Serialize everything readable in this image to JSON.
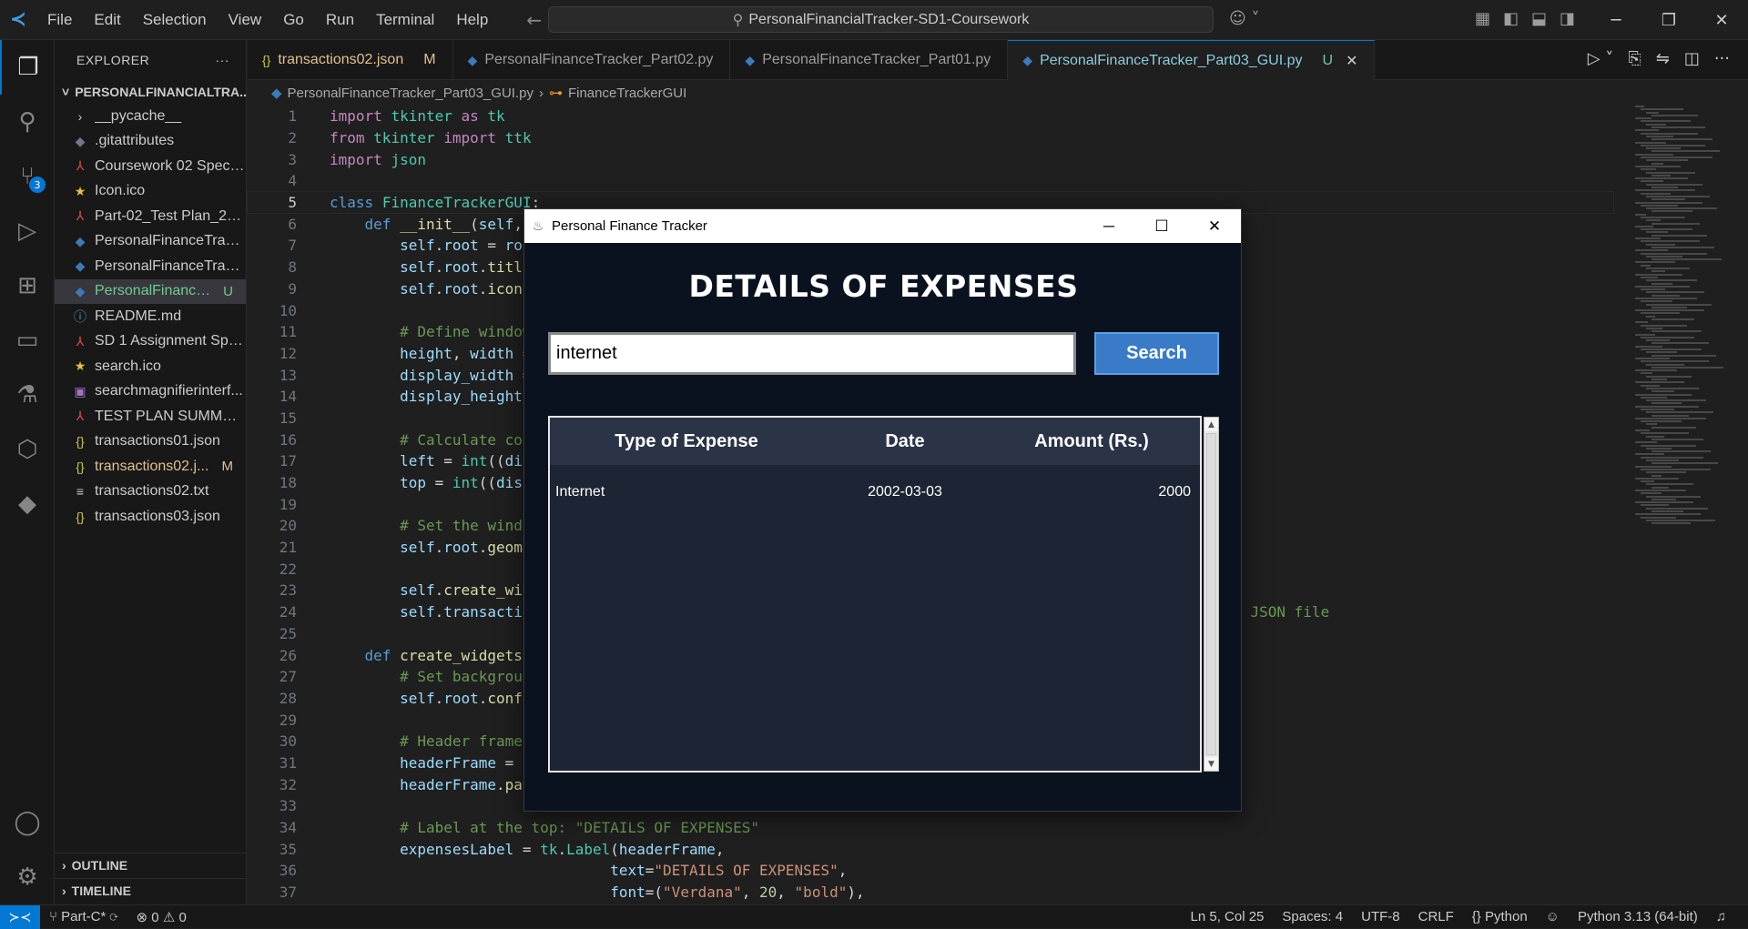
{
  "titlebar": {
    "menus": [
      "File",
      "Edit",
      "Selection",
      "View",
      "Go",
      "Run",
      "Terminal",
      "Help"
    ],
    "search_text": "PersonalFinancialTracker-SD1-Coursework"
  },
  "explorer": {
    "title": "EXPLORER",
    "root": "PERSONALFINANCIALTRA...",
    "files": [
      {
        "name": "__pycache__",
        "icon": "chevron-right-icon",
        "glyph": "›",
        "color": "#cccccc",
        "status": ""
      },
      {
        "name": ".gitattributes",
        "icon": "git-icon",
        "glyph": "◆",
        "color": "#6c7a89",
        "status": ""
      },
      {
        "name": "Coursework 02 Specif...",
        "icon": "pdf-icon",
        "glyph": "⅄",
        "color": "#e34c4c",
        "status": ""
      },
      {
        "name": "Icon.ico",
        "icon": "star-icon",
        "glyph": "★",
        "color": "#e8c33a",
        "status": ""
      },
      {
        "name": "Part-02_Test Plan_202...",
        "icon": "pdf-icon",
        "glyph": "⅄",
        "color": "#e34c4c",
        "status": ""
      },
      {
        "name": "PersonalFinanceTrack...",
        "icon": "python-icon",
        "glyph": "◆",
        "color": "#3d7ab8",
        "status": ""
      },
      {
        "name": "PersonalFinanceTrack...",
        "icon": "python-icon",
        "glyph": "◆",
        "color": "#3d7ab8",
        "status": ""
      },
      {
        "name": "PersonalFinance...",
        "icon": "python-icon",
        "glyph": "◆",
        "color": "#3d7ab8",
        "status": "U",
        "selected": true
      },
      {
        "name": "README.md",
        "icon": "info-icon",
        "glyph": "ⓘ",
        "color": "#519aba",
        "status": ""
      },
      {
        "name": "SD 1 Assignment Spe...",
        "icon": "pdf-icon",
        "glyph": "⅄",
        "color": "#e34c4c",
        "status": ""
      },
      {
        "name": "search.ico",
        "icon": "star-icon",
        "glyph": "★",
        "color": "#e8c33a",
        "status": ""
      },
      {
        "name": "searchmagnifierinterf...",
        "icon": "image-icon",
        "glyph": "▣",
        "color": "#a074c4",
        "status": ""
      },
      {
        "name": "TEST PLAN SUMMAR...",
        "icon": "pdf-icon",
        "glyph": "⅄",
        "color": "#e34c4c",
        "status": ""
      },
      {
        "name": "transactions01.json",
        "icon": "json-icon",
        "glyph": "{}",
        "color": "#cbcb41",
        "status": ""
      },
      {
        "name": "transactions02.j...",
        "icon": "json-icon",
        "glyph": "{}",
        "color": "#cbcb41",
        "status": "M"
      },
      {
        "name": "transactions02.txt",
        "icon": "text-icon",
        "glyph": "≡",
        "color": "#cccccc",
        "status": ""
      },
      {
        "name": "transactions03.json",
        "icon": "json-icon",
        "glyph": "{}",
        "color": "#cbcb41",
        "status": ""
      }
    ],
    "outline": "OUTLINE",
    "timeline": "TIMELINE"
  },
  "tabs": [
    {
      "label": "transactions02.json",
      "status": "M",
      "icon": "{}",
      "active": false
    },
    {
      "label": "PersonalFinanceTracker_Part02.py",
      "status": "",
      "icon": "◆",
      "active": false
    },
    {
      "label": "PersonalFinanceTracker_Part01.py",
      "status": "",
      "icon": "◆",
      "active": false
    },
    {
      "label": "PersonalFinanceTracker_Part03_GUI.py",
      "status": "U",
      "icon": "◆",
      "active": true
    }
  ],
  "breadcrumb": {
    "file": "PersonalFinanceTracker_Part03_GUI.py",
    "symbol": "FinanceTrackerGUI"
  },
  "code_lines": [
    "<span class=\"kw\">import</span> <span class=\"cls\">tkinter</span> <span class=\"kw\">as</span> <span class=\"cls\">tk</span>",
    "<span class=\"kw\">from</span> <span class=\"cls\">tkinter</span> <span class=\"kw\">import</span> <span class=\"cls\">ttk</span>",
    "<span class=\"kw\">import</span> <span class=\"cls\">json</span>",
    "",
    "<span class=\"kw2\">class</span> <span class=\"cls\">FinanceTrackerGUI</span>:",
    "    <span class=\"kw2\">def</span> <span class=\"fn\">__init__</span>(<span class=\"var\">self</span>, <span class=\"var\">root</span>):",
    "        <span class=\"var\">self</span>.<span class=\"var\">root</span> = <span class=\"var\">root</span>",
    "        <span class=\"var\">self</span>.<span class=\"var\">root</span>.<span class=\"fn\">title</span>(<span class=\"str\">\"Personal Finance Tracker\"</span>)",
    "        <span class=\"var\">self</span>.<span class=\"var\">root</span>.<span class=\"fn\">iconbitmap</span>(<span class=\"str\">\"Icon.ico\"</span>)",
    "",
    "        <span class=\"cm\"># Define window size</span>",
    "        <span class=\"var\">height</span>, <span class=\"var\">width</span> = <span class=\"num\">550</span>, <span class=\"num\">800</span>",
    "        <span class=\"var\">display_width</span> = <span class=\"var\">self</span>.<span class=\"var\">root</span>.<span class=\"fn\">winfo_screenwidth</span>()",
    "        <span class=\"var\">display_height</span> = <span class=\"var\">self</span>.<span class=\"var\">root</span>.<span class=\"fn\">winfo_screenheight</span>()",
    "",
    "        <span class=\"cm\"># Calculate coordinates</span>",
    "        <span class=\"var\">left</span> = <span class=\"cls\">int</span>((<span class=\"var\">display_width</span> / <span class=\"num\">2</span>) - (<span class=\"var\">width</span> / <span class=\"num\">2</span>))",
    "        <span class=\"var\">top</span> = <span class=\"cls\">int</span>((<span class=\"var\">display_height</span> / <span class=\"num\">2</span>) - (<span class=\"var\">height</span> / <span class=\"num\">2</span>))",
    "",
    "        <span class=\"cm\"># Set the window</span>",
    "        <span class=\"var\">self</span>.<span class=\"var\">root</span>.<span class=\"fn\">geometry</span>(<span class=\"str\">f\"{width}x{height}+{left}+{top}\"</span>)",
    "",
    "        <span class=\"var\">self</span>.<span class=\"fn\">create_widgets</span>()",
    "        <span class=\"var\">self</span>.<span class=\"var\">transactions</span> = <span class=\"var\">self</span>.<span class=\"fn\">load_transactions</span>(<span class=\"str\">\"transactions02.json\"</span>)                    <span class=\"cm\"># Load from JSON file</span>",
    "",
    "    <span class=\"kw2\">def</span> <span class=\"fn\">create_widgets</span>(<span class=\"var\">self</span>):",
    "        <span class=\"cm\"># Set background</span>",
    "        <span class=\"var\">self</span>.<span class=\"var\">root</span>.<span class=\"fn\">config</span>(<span class=\"var\">bg</span>=<span class=\"str\">\"#0a1220\"</span>)",
    "",
    "        <span class=\"cm\"># Header frame</span>",
    "        <span class=\"var\">headerFrame</span> = <span class=\"cls\">tk</span>.<span class=\"cls\">Frame</span>(<span class=\"var\">self</span>.<span class=\"var\">root</span>)",
    "        <span class=\"var\">headerFrame</span>.<span class=\"fn\">pack</span>()",
    "",
    "        <span class=\"cm\"># Label at the top: \"DETAILS OF EXPENSES\"</span>",
    "        <span class=\"var\">expensesLabel</span> = <span class=\"cls\">tk</span>.<span class=\"cls\">Label</span>(<span class=\"var\">headerFrame</span>,",
    "                                <span class=\"var\">text</span>=<span class=\"str\">\"DETAILS OF EXPENSES\"</span>,",
    "                                <span class=\"var\">font</span>=(<span class=\"str\">\"Verdana\"</span>, <span class=\"num\">20</span>, <span class=\"str\">\"bold\"</span>),"
  ],
  "statusbar": {
    "branch": "Part-C*",
    "errors": "0",
    "warnings": "0",
    "position": "Ln 5, Col 25",
    "spaces": "Spaces: 4",
    "encoding": "UTF-8",
    "eol": "CRLF",
    "language": "Python",
    "interpreter": "Python 3.13 (64-bit)"
  },
  "tk_app": {
    "window_title": "Personal Finance Tracker",
    "heading": "DETAILS OF EXPENSES",
    "search_value": "internet",
    "search_button": "Search",
    "columns": [
      "Type of Expense",
      "Date",
      "Amount (Rs.)"
    ],
    "rows": [
      {
        "type": "Internet",
        "date": "2002-03-03",
        "amount": "2000"
      }
    ]
  },
  "colors": {
    "accent": "#0078d4",
    "tk_background": "#0a1220",
    "tk_button": "#3a7bc8"
  }
}
